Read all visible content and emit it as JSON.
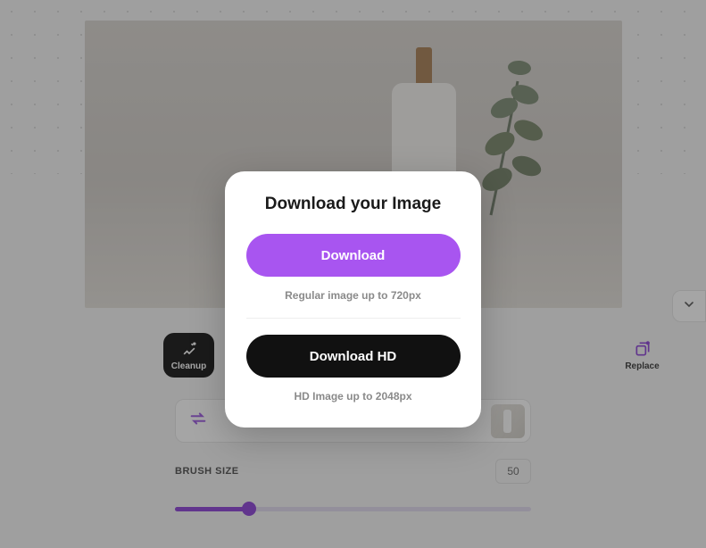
{
  "modal": {
    "title": "Download your Image",
    "download_label": "Download",
    "download_caption": "Regular image up to 720px",
    "download_hd_label": "Download HD",
    "download_hd_caption": "HD Image up to 2048px"
  },
  "toolbar": {
    "cleanup_label": "Cleanup",
    "replace_label": "Replace"
  },
  "brush": {
    "label": "BRUSH SIZE",
    "value": "50"
  }
}
